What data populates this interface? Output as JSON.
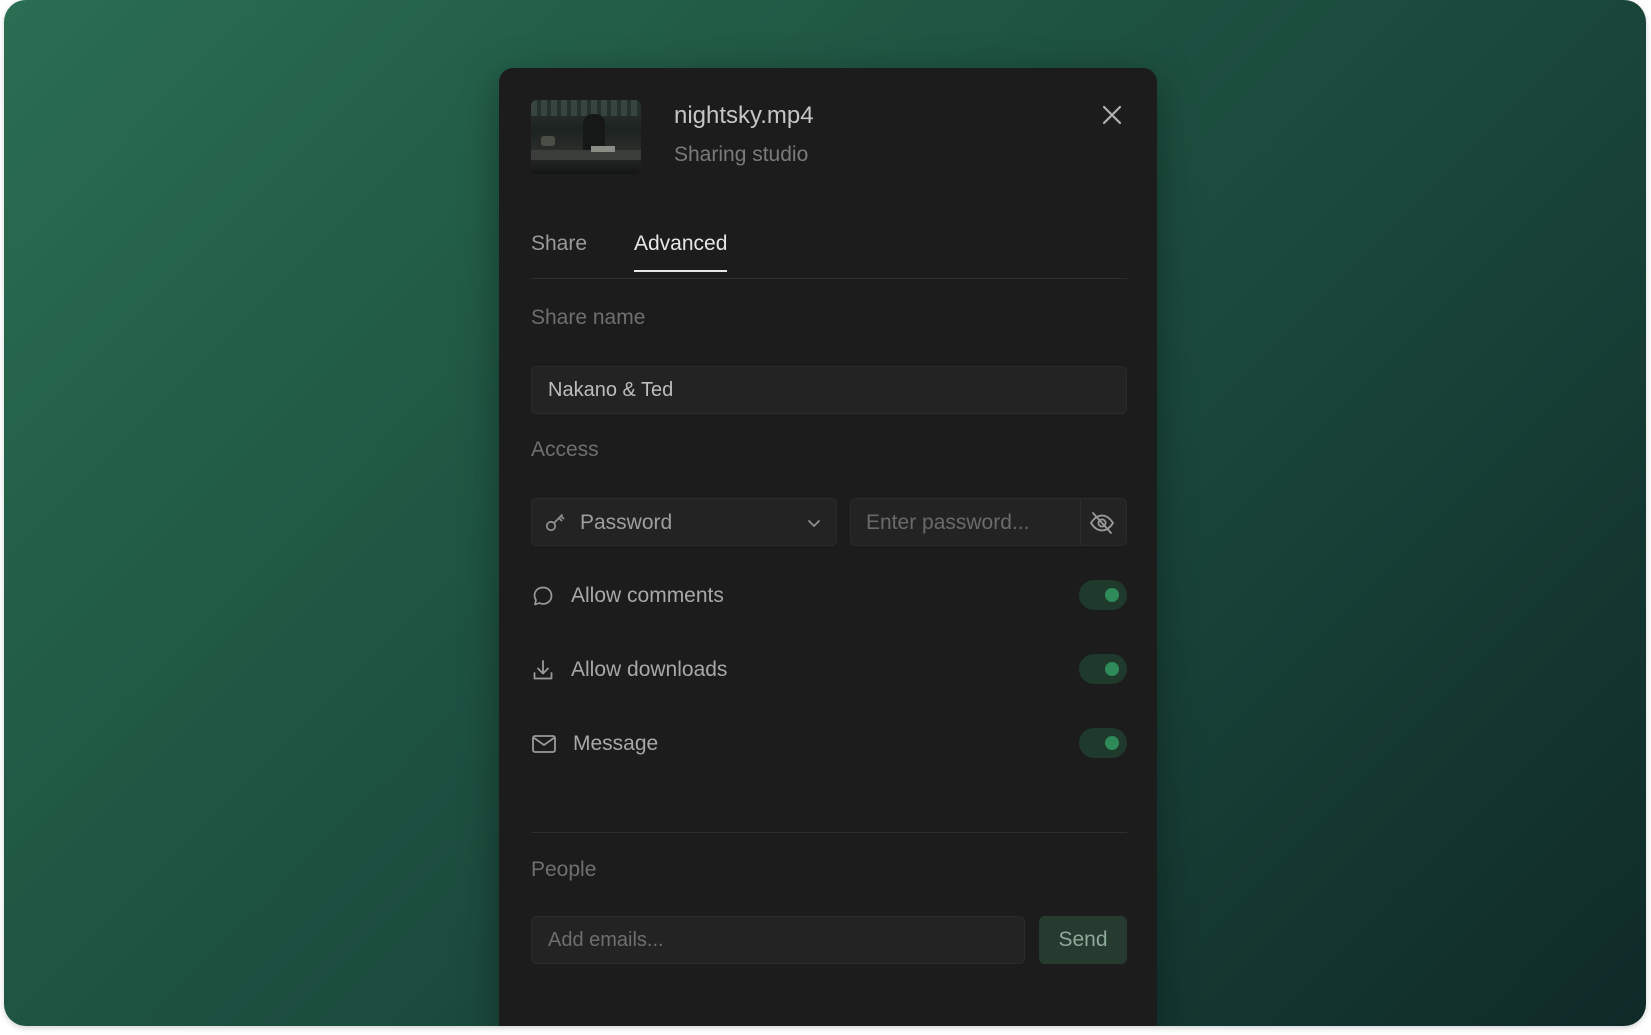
{
  "file": {
    "name": "nightsky.mp4",
    "subtitle": "Sharing studio"
  },
  "tabs": [
    {
      "label": "Share",
      "active": false
    },
    {
      "label": "Advanced",
      "active": true
    }
  ],
  "share_name": {
    "label": "Share name",
    "value": "Nakano & Ted"
  },
  "access": {
    "label": "Access",
    "mode": "Password",
    "password_placeholder": "Enter password...",
    "icons": {
      "mode": "key-icon",
      "dropdown": "chevron-down-icon",
      "visibility": "eye-off-icon"
    }
  },
  "options": [
    {
      "label": "Allow comments",
      "icon": "comment-icon",
      "enabled": true
    },
    {
      "label": "Allow downloads",
      "icon": "download-icon",
      "enabled": true
    },
    {
      "label": "Message",
      "icon": "mail-icon",
      "enabled": true
    }
  ],
  "people": {
    "label": "People",
    "placeholder": "Add emails...",
    "send_label": "Send"
  },
  "colors": {
    "accent": "#2f8a5a",
    "modal_bg": "#1c1c1c",
    "backdrop_start": "#2a6e53",
    "backdrop_end": "#0f2a28"
  }
}
